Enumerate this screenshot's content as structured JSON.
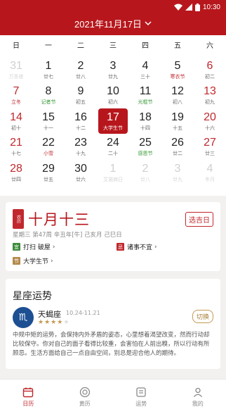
{
  "status": {
    "time": "10:30"
  },
  "header": {
    "title": "2021年11月17日"
  },
  "weekdays": [
    "日",
    "一",
    "二",
    "三",
    "四",
    "五",
    "六"
  ],
  "calendar": [
    [
      {
        "d": "31",
        "l": "万圣夜",
        "dim": true
      },
      {
        "d": "1",
        "l": "廿七"
      },
      {
        "d": "2",
        "l": "廿八"
      },
      {
        "d": "3",
        "l": "廿九"
      },
      {
        "d": "4",
        "l": "三十"
      },
      {
        "d": "5",
        "l": "寒衣节",
        "lc": "red"
      },
      {
        "d": "6",
        "l": "初二"
      }
    ],
    [
      {
        "d": "7",
        "l": "立冬",
        "lc": "red"
      },
      {
        "d": "8",
        "l": "记者节",
        "lc": "green"
      },
      {
        "d": "9",
        "l": "初五"
      },
      {
        "d": "10",
        "l": "初六"
      },
      {
        "d": "11",
        "l": "光棍节",
        "lc": "green"
      },
      {
        "d": "12",
        "l": "初八"
      },
      {
        "d": "13",
        "l": "初九"
      }
    ],
    [
      {
        "d": "14",
        "l": "初十"
      },
      {
        "d": "15",
        "l": "十一"
      },
      {
        "d": "16",
        "l": "十二"
      },
      {
        "d": "17",
        "l": "大学生节",
        "sel": true
      },
      {
        "d": "18",
        "l": "十四"
      },
      {
        "d": "19",
        "l": "十五"
      },
      {
        "d": "20",
        "l": "十六"
      }
    ],
    [
      {
        "d": "21",
        "l": "十七"
      },
      {
        "d": "22",
        "l": "小雪",
        "lc": "red"
      },
      {
        "d": "23",
        "l": "十九"
      },
      {
        "d": "24",
        "l": "二十"
      },
      {
        "d": "25",
        "l": "感恩节",
        "lc": "green"
      },
      {
        "d": "26",
        "l": "廿二"
      },
      {
        "d": "27",
        "l": "廿三"
      }
    ],
    [
      {
        "d": "28",
        "l": "廿四"
      },
      {
        "d": "29",
        "l": "廿五"
      },
      {
        "d": "30",
        "l": "廿六"
      },
      {
        "d": "1",
        "l": "艾滋病日",
        "dim": true
      },
      {
        "d": "2",
        "l": "廿八",
        "dim": true
      },
      {
        "d": "3",
        "l": "廿九",
        "dim": true
      },
      {
        "d": "4",
        "l": "冬月",
        "dim": true
      }
    ]
  ],
  "almanac": {
    "badge": "农历",
    "lunar_date": "十月十三",
    "pick_button": "选吉日",
    "info": "星期三 第47周 辛丑年[牛] 己亥月 己巳日",
    "yi_tag": "宜",
    "yi_text": "打扫 破屋",
    "ji_tag": "忌",
    "ji_text": "诸事不宜",
    "fest_tag": "节",
    "fest_text": "大学生节",
    "colors": {
      "yi": "#3a8a3a",
      "ji": "#c0282d",
      "fest": "#b48a4c"
    }
  },
  "horoscope": {
    "title": "星座运势",
    "sign_name": "天蝎座",
    "sign_dates": "10.24-11.21",
    "stars": 4,
    "switch_button": "切换",
    "description": "中规中矩的运势，会保持内外矛盾的姿态，心里想着渴望改变，然而行动却比较保守。你对自己的面子看得比较重，会害怕在人前出糗，所以行动有所顾忌。生活方面给自己一点自由空间，别总是迎合他人的期待。"
  },
  "tabs": [
    {
      "label": "日历",
      "icon": "calendar-icon",
      "active": true
    },
    {
      "label": "黄历",
      "icon": "almanac-icon"
    },
    {
      "label": "运势",
      "icon": "fortune-icon"
    },
    {
      "label": "我的",
      "icon": "profile-icon"
    }
  ],
  "theme": {
    "primary": "#b7171c",
    "accent": "#c0282d"
  }
}
